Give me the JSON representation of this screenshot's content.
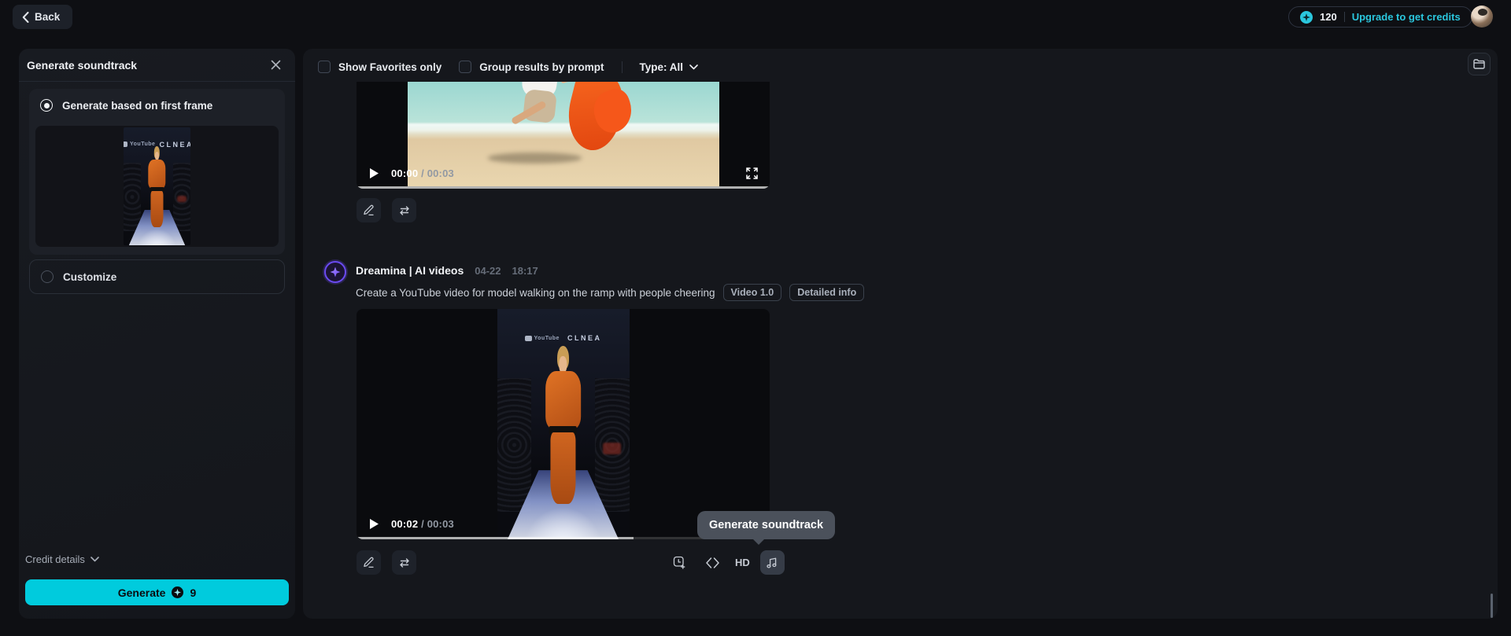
{
  "topbar": {
    "back_label": "Back",
    "credits": "120",
    "upgrade_label": "Upgrade to get credits"
  },
  "soundtrack_panel": {
    "title": "Generate soundtrack",
    "option_first_frame": "Generate based on first frame",
    "option_customize": "Customize",
    "credit_details_label": "Credit details",
    "generate_label": "Generate",
    "generate_cost": "9"
  },
  "filters": {
    "favorites_label": "Show Favorites only",
    "group_label": "Group results by prompt",
    "type_label": "Type: All"
  },
  "video_overlay": {
    "logo": "YouTube",
    "brand": "CLNEA"
  },
  "results": {
    "0": {
      "time_current": "00:00",
      "time_total": "00:03"
    },
    "1": {
      "author": "Dreamina | AI videos",
      "date": "04-22",
      "time": "18:17",
      "prompt": "Create a YouTube video for model walking on the ramp with people cheering",
      "tags": {
        "0": "Video 1.0",
        "1": "Detailed info"
      },
      "time_current": "00:02",
      "time_total": "00:03",
      "hd_label": "HD",
      "progress_percent": 67
    }
  },
  "ui": {
    "time_separator": "/",
    "tooltip": "Generate soundtrack"
  },
  "colors": {
    "accent_cyan": "#00cbdd",
    "upgrade_cyan": "#2bc7de",
    "panel_bg": "#15171c",
    "page_bg": "#0e0f13",
    "tooltip_bg": "#4b515b",
    "logo_purple": "#6a4af0"
  }
}
